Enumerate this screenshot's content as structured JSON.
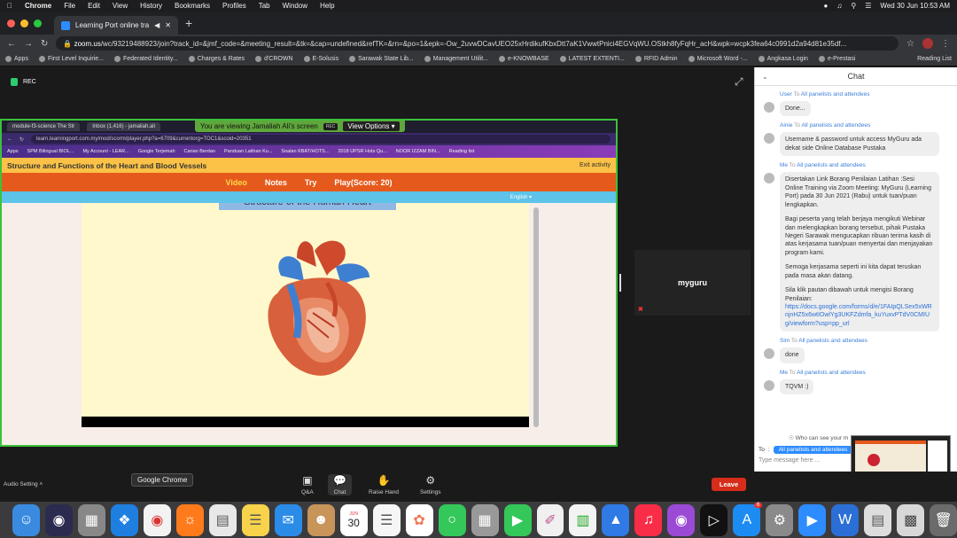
{
  "menubar": {
    "items": [
      "Chrome",
      "File",
      "Edit",
      "View",
      "History",
      "Bookmarks",
      "Profiles",
      "Tab",
      "Window",
      "Help"
    ],
    "datetime": "Wed 30 Jun  10:53 AM"
  },
  "browser": {
    "tab_title": "Learning Port online traini",
    "url_host": "zoom.us",
    "url_path": "/wc/93219488923/join?track_id=&jmf_code=&meeting_result=&tk=&cap=undefined&refTK=&rn=&po=1&epk=-Ow_2uvwDCavUEO25xHrdikufKbxDtt7aK1VwwtPnici4EGVqWU.OStkh8fyFqHr_acH&wpk=wcpk3fea64c0991d2a94d81e35df...",
    "bookmarks": [
      "Apps",
      "First Level Inquirie...",
      "Federated Identity...",
      "Charges & Rates",
      "d'CROWN",
      "E-Solusis",
      "Sarawak State Lib...",
      "Management Utilit...",
      "e-KNOWBASE",
      "LATEST EXTENTI...",
      "RFID Admin",
      "Microsoft Word -...",
      "Angkasa Login",
      "e-Prestasi"
    ],
    "reading_list": "Reading List"
  },
  "zoom": {
    "rec_label": "REC",
    "view_banner": "You are viewing Jamaliah Ali's screen",
    "view_options": "View Options",
    "participant_name": "myguru",
    "controls": {
      "audio": "Audio Setting",
      "qa": "Q&A",
      "chat": "Chat",
      "raise_hand": "Raise Hand",
      "settings": "Settings",
      "leave": "Leave"
    },
    "tooltip": "Google Chrome"
  },
  "shared": {
    "inner_tabs": [
      "module-f3-science The Str",
      "Inbox (1,416) - jamaliah.ali"
    ],
    "inner_url": "learn.learningport.com.my/mod/scorm/player.php?a=6709&currentorg=TOC1&scoid=20351",
    "inner_bookmarks": [
      "Apps",
      "SPM Bilingual BIOL...",
      "My Account - LEAR...",
      "Google Terjemah",
      "Carian Berdan",
      "Panduan Latihan Ku...",
      "Soalan KBAT/HOTS...",
      "2018 UPSR Hots Qu...",
      "NOOR IZZAM BIN...",
      "Reading list"
    ],
    "course_title": "Structure and Functions of the Heart and Blood Vessels",
    "exit": "Exit activity",
    "nav": [
      "Video",
      "Notes",
      "Try",
      "Play(Score: 20)"
    ],
    "language": "English",
    "lesson_heading": "Structure of the Human Heart"
  },
  "chat": {
    "title": "Chat",
    "to_label": "To",
    "messages": [
      {
        "sender": "User",
        "to": "All panelists and attendees",
        "text": "Done..."
      },
      {
        "sender": "Ainie",
        "to": "All panelists and attendees",
        "text": "Username & password untuk access MyGuru ada dekat side Online Database Pustaka"
      },
      {
        "sender": "Me",
        "to": "All panelists and attendees",
        "paragraphs": [
          "Disertakan Link Borang Penilaian Latihan :Sesi Online Training via Zoom Meeting: MyGuru (Learning Port) pada 30 Jun 2021 (Rabu) untuk tuan/puan lengkapkan.",
          "Bagi peserta yang telah berjaya mengikuti Webinar dan melengkapkan borang tersebut, pihak Pustaka Negeri Sarawak mengucapkan ribuan terima kasih di atas kerjasama tuan/puan menyertai dan menjayakan program kami.",
          "Semoga kerjasama seperti ini kita dapat teruskan pada masa akan datang.",
          "Sila klik pautan dibawah untuk mengisi Borang Penilaian:"
        ],
        "link": "https://docs.google.com/forms/d/e/1FAIpQLSex5xWRnjnHZ5x6wtIOwlYg3UKFZdmfa_kuYuxvPTdV0CMIUg/viewform?usp=pp_url"
      },
      {
        "sender": "Sim",
        "to": "All panelists and attendees",
        "text": "done"
      },
      {
        "sender": "Me",
        "to": "All panelists and attendees",
        "text": "TQVM :)"
      }
    ],
    "who_can_see": "Who can see your m",
    "recipient": "All panelists and attendees",
    "input_placeholder": "Type message here ..."
  },
  "dock": {
    "calendar_day": "30",
    "calendar_month": "JUN",
    "appstore_badge": "6"
  }
}
